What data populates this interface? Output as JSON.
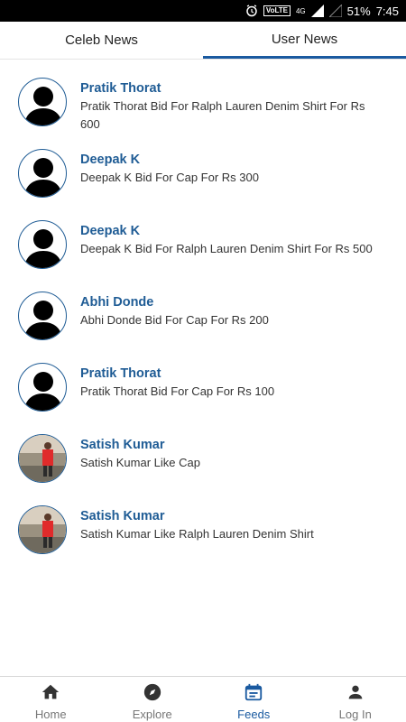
{
  "status": {
    "volte": "VoLTE",
    "network": "4G",
    "battery": "51%",
    "time": "7:45"
  },
  "tabs": [
    {
      "label": "Celeb News",
      "active": false
    },
    {
      "label": "User News",
      "active": true
    }
  ],
  "news": [
    {
      "name": "Pratik Thorat",
      "text": "Pratik Thorat Bid For Ralph Lauren Denim Shirt For Rs 600",
      "avatar": "silhouette"
    },
    {
      "name": "Deepak K",
      "text": "Deepak K Bid For Cap For Rs 300",
      "avatar": "silhouette"
    },
    {
      "name": "Deepak K",
      "text": "Deepak K Bid For Ralph Lauren Denim Shirt For Rs 500",
      "avatar": "silhouette"
    },
    {
      "name": "Abhi Donde",
      "text": "Abhi Donde Bid For Cap For Rs 200",
      "avatar": "silhouette"
    },
    {
      "name": "Pratik Thorat",
      "text": "Pratik Thorat Bid For Cap For Rs 100",
      "avatar": "silhouette"
    },
    {
      "name": "Satish Kumar",
      "text": "Satish Kumar Like Cap",
      "avatar": "photo"
    },
    {
      "name": "Satish Kumar",
      "text": "Satish Kumar Like Ralph Lauren Denim Shirt",
      "avatar": "photo"
    }
  ],
  "bottom_nav": [
    {
      "label": "Home",
      "icon": "home-icon",
      "active": false
    },
    {
      "label": "Explore",
      "icon": "compass-icon",
      "active": false
    },
    {
      "label": "Feeds",
      "icon": "calendar-icon",
      "active": true
    },
    {
      "label": "Log In",
      "icon": "person-icon",
      "active": false
    }
  ],
  "colors": {
    "accent": "#1a5aa0",
    "name": "#1f5c95"
  }
}
